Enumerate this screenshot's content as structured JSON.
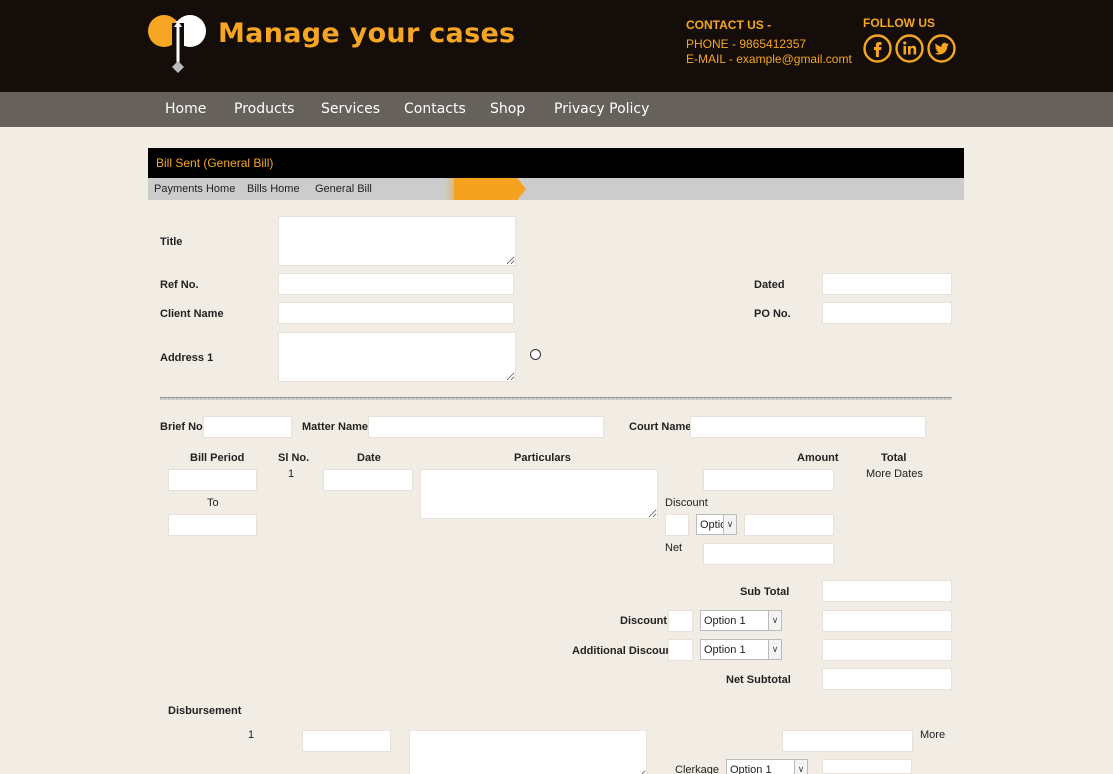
{
  "header": {
    "brand": "Manage your cases",
    "contact_title": "CONTACT US -",
    "phone": "PHONE - 9865412357",
    "email": "E-MAIL - example@gmail.comt",
    "follow_title": "FOLLOW US",
    "social": [
      "facebook",
      "linkedin",
      "twitter"
    ]
  },
  "nav": [
    "Home",
    "Products",
    "Services",
    "Contacts",
    "Shop",
    "Privacy Policy"
  ],
  "panel": {
    "title": "Bill Sent (General Bill)",
    "breadcrumb": [
      "Payments Home",
      "Bills Home",
      "General Bill"
    ]
  },
  "form": {
    "title": "Title",
    "ref_no": "Ref No.",
    "client_name": "Client Name",
    "address1": "Address 1",
    "dated": "Dated",
    "po_no": "PO No.",
    "brief_no": "Brief No.",
    "matter_name": "Matter Name",
    "court_name": "Court Name"
  },
  "bill": {
    "bill_period": "Bill Period",
    "to": "To",
    "sl_no": "Sl No.",
    "row_no": "1",
    "date": "Date",
    "particulars": "Particulars",
    "amount": "Amount",
    "total": "Total",
    "more_dates": "More Dates",
    "discount": "Discount",
    "discount_option": "Optio",
    "net": "Net"
  },
  "totals": {
    "sub_total": "Sub Total",
    "discount": "Discount",
    "discount_option": "Option 1",
    "additional_discount": "Additional Discount",
    "additional_option": "Option 1",
    "net_subtotal": "Net Subtotal"
  },
  "disbursement": {
    "title": "Disbursement",
    "row_no": "1",
    "more": "More",
    "clerkage": "Clerkage",
    "clerkage_option": "Option 1"
  },
  "colors": {
    "accent": "#f6a623",
    "header_bg": "#140d0a",
    "nav_bg": "#66615b",
    "page_bg": "#f1ede5"
  }
}
